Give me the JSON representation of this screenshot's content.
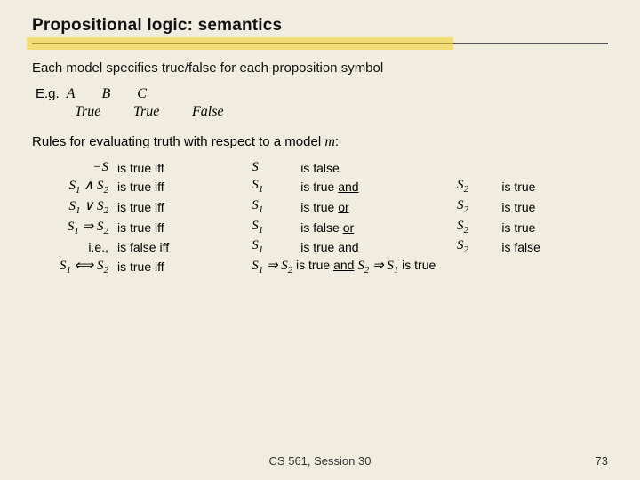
{
  "title": "Propositional logic: semantics",
  "intro": "Each model specifies true/false for each proposition symbol",
  "eg_label": "E.g.",
  "eg_vars": [
    "A",
    "B",
    "C"
  ],
  "eg_vals": [
    "True",
    "True",
    "False"
  ],
  "rules_intro": "Rules for evaluating truth with respect to a model m:",
  "rules": [
    {
      "formula": "¬S",
      "is_true_iff": "is true iff",
      "s1": "S",
      "cond": "is false",
      "s2": "",
      "result": ""
    },
    {
      "formula": "S₁ ∧ S₂",
      "is_true_iff": "is true iff",
      "s1": "S₁",
      "cond": "is true",
      "conj": "and",
      "s2": "S₂",
      "result": "is true"
    },
    {
      "formula": "S₁ ∨ S₂",
      "is_true_iff": "is true iff",
      "s1": "S₁",
      "cond": "is true",
      "conj": "or",
      "s2": "S₂",
      "result": "is true"
    },
    {
      "formula": "S₁ ⇒ S₂",
      "is_true_iff": "is true iff",
      "s1": "S₁",
      "cond": "is false",
      "conj": "or",
      "s2": "S₂",
      "result": "is true"
    },
    {
      "formula": "i.e.,",
      "is_true_iff": "is false iff",
      "s1": "S₁",
      "cond": "is true and",
      "conj": "",
      "s2": "S₂",
      "result": "is false"
    },
    {
      "formula": "S₁ ⟺ S₂",
      "is_true_iff": "is true iff S₁ ⇒ S₂ is true",
      "conj2": "and",
      "s2b": "S₂ ⇒ S₁",
      "result2": "is true"
    }
  ],
  "footer_label": "CS 561, Session 30",
  "footer_page": "73"
}
